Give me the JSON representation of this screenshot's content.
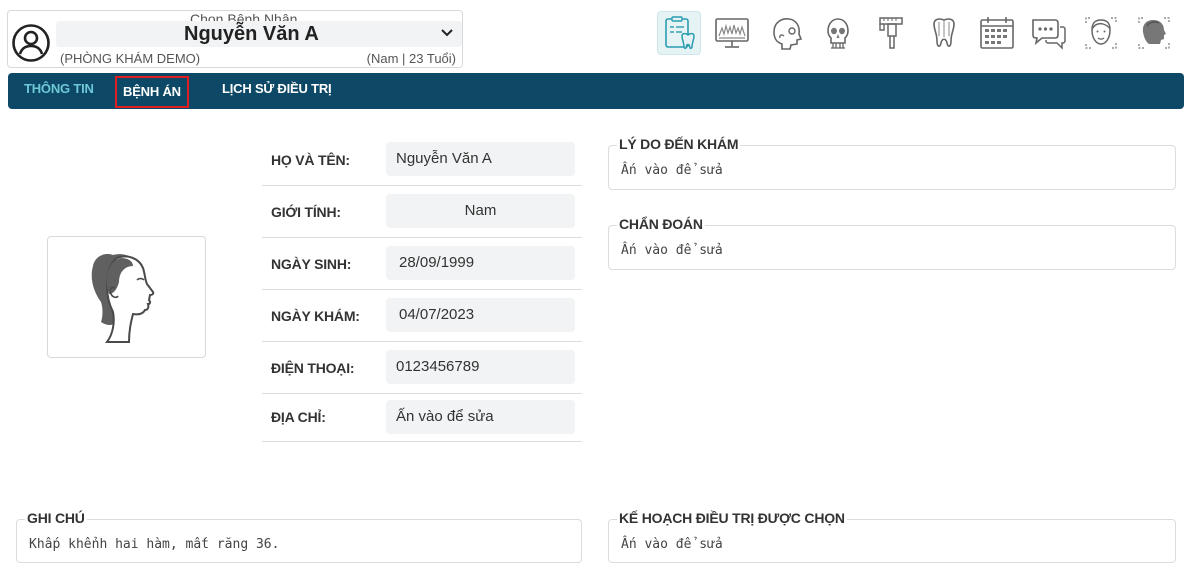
{
  "header": {
    "caption": "Chọn Bệnh Nhân",
    "patient_name": "Nguyễn Văn A",
    "clinic": "(PHÒNG KHÁM DEMO)",
    "demographics": "(Nam | 23 Tuổi)"
  },
  "toolbar": {
    "icons": [
      "medical-record-tooth-icon",
      "xray-monitor-icon",
      "skull-side-icon",
      "skull-front-icon",
      "caliper-icon",
      "tooth-icon",
      "calendar-icon",
      "chat-icon",
      "face-front-icon",
      "face-side-icon"
    ],
    "accent": "#e6f3f5"
  },
  "nav": {
    "tabs": [
      "THÔNG TIN",
      "BỆNH ÁN",
      "LỊCH SỬ ĐIỀU TRỊ"
    ],
    "background": "#0d4866",
    "active_color": "#6ec8d6",
    "highlight_color": "#e02020"
  },
  "info": {
    "rows": [
      {
        "label": "HỌ VÀ TÊN:",
        "value": "Nguyễn Văn A"
      },
      {
        "label": "GIỚI TÍNH:",
        "value": "Nam"
      },
      {
        "label": "NGÀY SINH:",
        "value": "28/09/1999"
      },
      {
        "label": "NGÀY KHÁM:",
        "value": "04/07/2023"
      },
      {
        "label": "ĐIỆN THOẠI:",
        "value": "0123456789"
      },
      {
        "label": "ĐỊA CHỈ:",
        "value": "Ấn vào để sửa"
      }
    ]
  },
  "fields": {
    "reason": {
      "label": "LÝ DO ĐẾN KHÁM",
      "value": "Ấn vào để sửa"
    },
    "diagnosis": {
      "label": "CHẨN ĐOÁN",
      "value": "Ấn vào để sửa"
    },
    "notes": {
      "label": "GHI CHÚ",
      "value": "Khấp khểnh hai hàm, mất răng 36."
    },
    "plan": {
      "label": "KẾ HOẠCH ĐIỀU TRỊ ĐƯỢC CHỌN",
      "value": "Ấn vào để sửa"
    }
  }
}
